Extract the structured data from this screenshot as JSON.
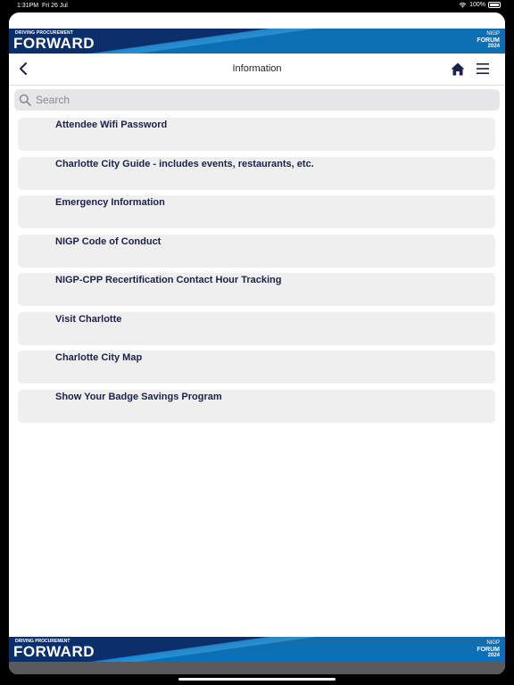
{
  "status": {
    "time": "1:31PM",
    "date": "Fri 26 Jul",
    "battery": "100%"
  },
  "banner": {
    "tagline": "DRIVING PROCUREMENT",
    "title": "FORWARD",
    "logo_line1": "NIGP",
    "logo_line2": "FORUM",
    "logo_line3": "2024"
  },
  "navbar": {
    "title": "Information"
  },
  "search": {
    "placeholder": "Search"
  },
  "items": [
    {
      "label": "Attendee Wifi Password"
    },
    {
      "label": "Charlotte City Guide - includes events, restaurants, etc."
    },
    {
      "label": "Emergency Information"
    },
    {
      "label": "NIGP Code of Conduct"
    },
    {
      "label": "NIGP-CPP Recertification Contact Hour Tracking"
    },
    {
      "label": "Visit Charlotte"
    },
    {
      "label": "Charlotte City Map"
    },
    {
      "label": "Show Your Badge Savings Program"
    }
  ],
  "footer": {
    "tagline": "DRIVING PROCUREMENT",
    "title": "FORWARD",
    "logo_line1": "NIGP",
    "logo_line2": "FORUM",
    "logo_line3": "2024"
  },
  "icons": {
    "back": "chevron-left-icon",
    "home": "home-icon",
    "menu": "hamburger-menu-icon",
    "search": "search-icon",
    "wifi": "wifi-icon",
    "battery": "battery-icon"
  },
  "colors": {
    "brand_blue": "#0d6fb3",
    "brand_navy": "#0a2f6b",
    "item_text": "#1b2148",
    "item_bg": "#efefef"
  }
}
